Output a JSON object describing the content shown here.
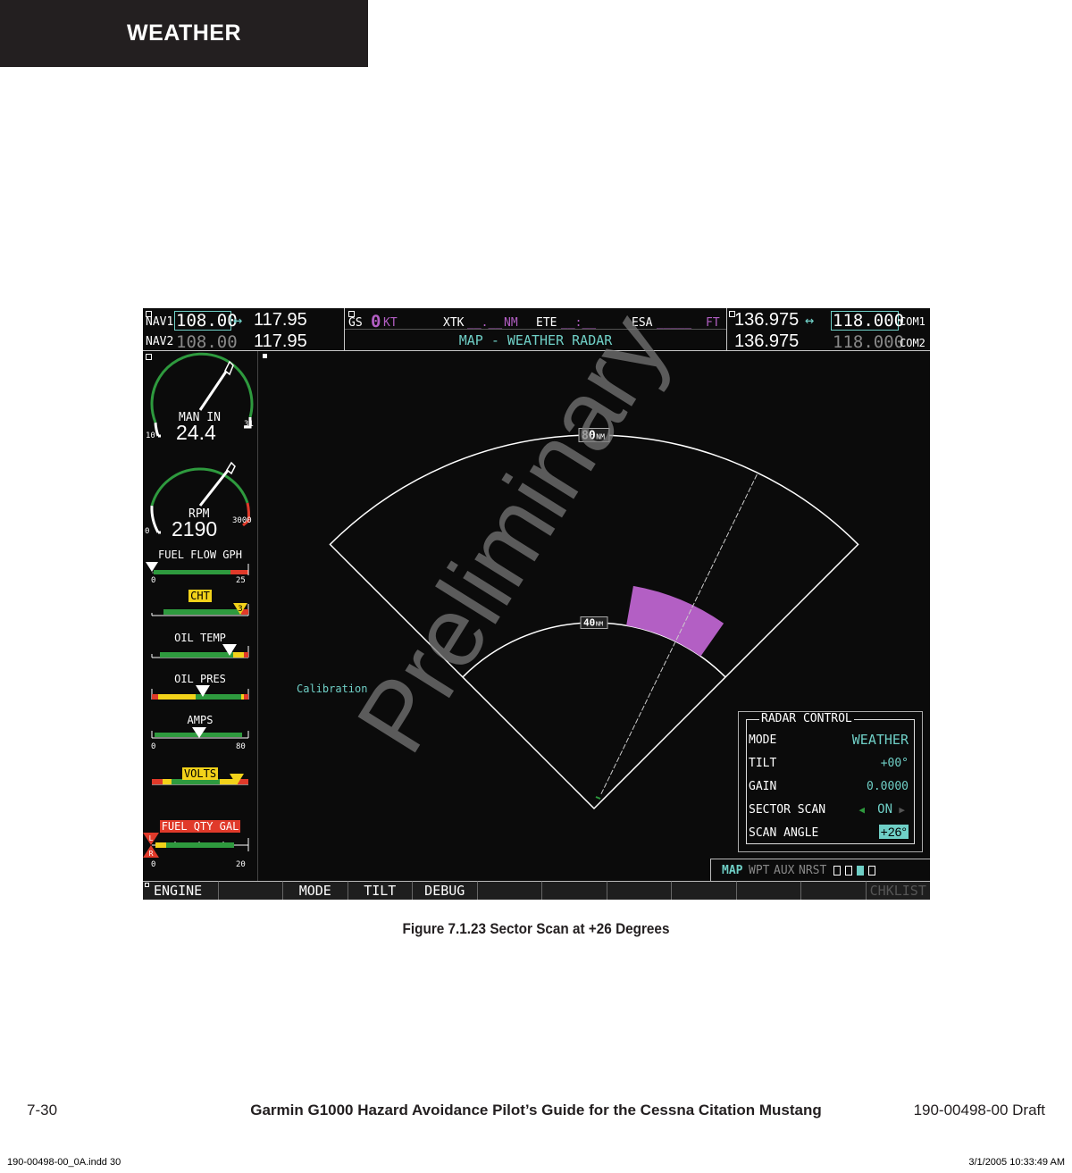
{
  "page": {
    "section_tab": "WEATHER",
    "caption": "Figure 7.1.23  Sector Scan at +26 Degrees",
    "footer_left": "7-30",
    "footer_center": "Garmin G1000 Hazard Avoidance Pilot’s Guide for the Cessna Citation Mustang",
    "footer_right": "190-00498-00  Draft",
    "slug_left": "190-00498-00_0A.indd   30",
    "slug_right": "3/1/2005   10:33:49 AM",
    "watermark": "Preliminary"
  },
  "nav": {
    "nav1_label": "NAV1",
    "nav1_active": "108.00",
    "nav1_standby": "117.95",
    "nav2_label": "NAV2",
    "nav2_active": "108.00",
    "nav2_standby": "117.95",
    "swap_icon": "↔"
  },
  "com": {
    "com1_standby": "136.975",
    "com1_active": "118.000",
    "com1_label": "COM1",
    "com2_standby": "136.975",
    "com2_active": "118.000",
    "com2_label": "COM2",
    "swap_icon": "↔"
  },
  "datafields": {
    "gs_label": "GS",
    "gs_value": "0",
    "gs_unit": "KT",
    "xtk_label": "XTK",
    "xtk_value": "__.__",
    "xtk_unit": "NM",
    "ete_label": "ETE",
    "ete_value": "__:__",
    "esa_label": "ESA",
    "esa_value": "_____",
    "esa_unit": "FT"
  },
  "page_title": "MAP - WEATHER RADAR",
  "engine": {
    "man_in": {
      "label": "MAN IN",
      "value": "24.4",
      "min": "10",
      "max": "31"
    },
    "rpm": {
      "label": "RPM",
      "value": "2190",
      "min": "0",
      "max": "3000"
    },
    "fuel_flow": {
      "label": "FUEL FLOW GPH",
      "min": "0",
      "max": "25",
      "level": 0.0
    },
    "cht": {
      "label": "CHT",
      "cylinder": "3",
      "level": 0.95
    },
    "oil_temp": {
      "label": "OIL TEMP",
      "level": 0.8
    },
    "oil_pres": {
      "label": "OIL PRES",
      "level": 0.5
    },
    "amps": {
      "label": "AMPS",
      "min": "0",
      "max": "80",
      "level": 0.48
    },
    "volts": {
      "label": "VOLTS",
      "level": 0.88
    },
    "fuel_qty": {
      "label": "FUEL QTY GAL",
      "min": "0",
      "max": "20",
      "left_marker": "L",
      "right_marker": "R",
      "level": 0.0
    }
  },
  "radar": {
    "range_outer": "80",
    "range_inner": "40",
    "range_unit": "NM",
    "scan_angle_deg": 26,
    "calibration_label": "Calibration",
    "weather_cell_color": "#b35fc4"
  },
  "radar_control": {
    "title": "RADAR CONTROL",
    "rows": [
      {
        "label": "MODE",
        "value": "WEATHER"
      },
      {
        "label": "TILT",
        "value": "+00°"
      },
      {
        "label": "GAIN",
        "value": "0.0000"
      },
      {
        "label": "SECTOR SCAN",
        "value": "ON"
      },
      {
        "label": "SCAN ANGLE",
        "value": "+26°"
      }
    ]
  },
  "page_groups": {
    "items": [
      "MAP",
      "WPT",
      "AUX",
      "NRST"
    ],
    "active": "MAP"
  },
  "softkeys": [
    "ENGINE",
    "",
    "MODE",
    "TILT",
    "DEBUG",
    "",
    "",
    "",
    "",
    "",
    "",
    "CHKLIST"
  ],
  "colors": {
    "cyan": "#6fcfc6",
    "magenta": "#b35fc4",
    "green": "#2e9a3e",
    "yellow": "#f2d21a",
    "red": "#e03a2a"
  }
}
